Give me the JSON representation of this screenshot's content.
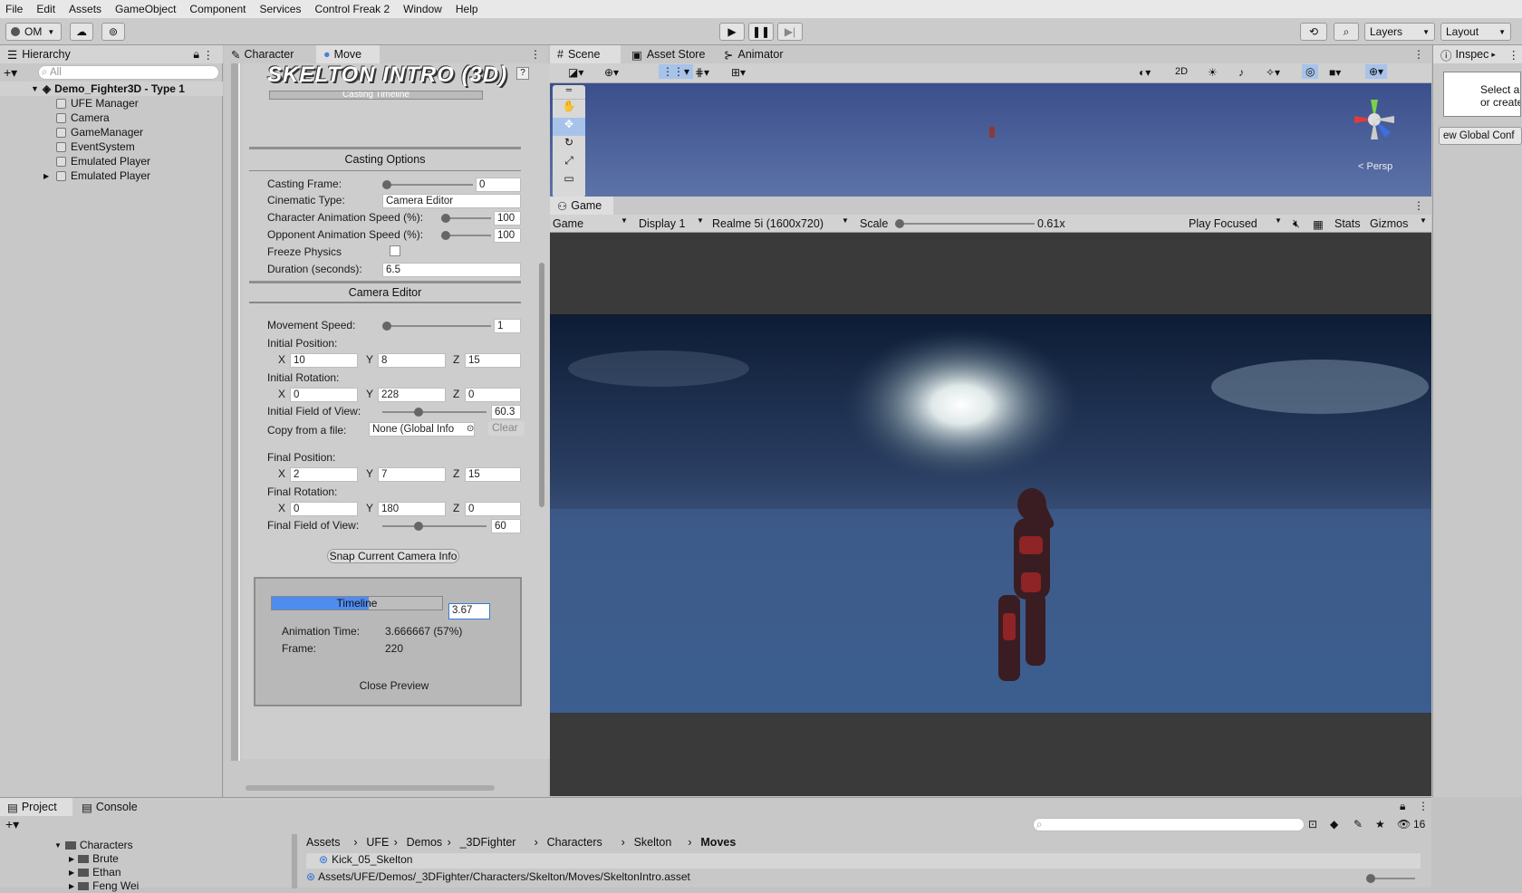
{
  "menu": [
    "File",
    "Edit",
    "Assets",
    "GameObject",
    "Component",
    "Services",
    "Control Freak 2",
    "Window",
    "Help"
  ],
  "toolbar": {
    "account": "OM",
    "layers": "Layers",
    "layout": "Layout"
  },
  "hierarchy": {
    "tab": "Hierarchy",
    "search_placeholder": "All",
    "scene": "Demo_Fighter3D - Type 1",
    "items": [
      "UFE Manager",
      "Camera",
      "GameManager",
      "EventSystem",
      "Emulated Player",
      "Emulated Player"
    ]
  },
  "editor": {
    "tabs": [
      "Character",
      "Move"
    ],
    "banner": "SKELTON INTRO (3D)",
    "timeline_header": "Casting Timeline",
    "casting_options": "Casting Options",
    "casting_frame_label": "Casting Frame:",
    "casting_frame": "0",
    "cinematic_type_label": "Cinematic Type:",
    "cinematic_type": "Camera Editor",
    "char_anim_label": "Character Animation Speed (%):",
    "char_anim": "100",
    "opp_anim_label": "Opponent Animation Speed (%):",
    "opp_anim": "100",
    "freeze_label": "Freeze Physics",
    "duration_label": "Duration (seconds):",
    "duration": "6.5",
    "camera_editor": "Camera Editor",
    "movement_label": "Movement Speed:",
    "movement": "1",
    "init_pos_label": "Initial Position:",
    "init_pos": {
      "x": "10",
      "y": "8",
      "z": "15"
    },
    "init_rot_label": "Initial Rotation:",
    "init_rot": {
      "x": "0",
      "y": "228",
      "z": "0"
    },
    "init_fov_label": "Initial Field of View:",
    "init_fov": "60.3",
    "copy_label": "Copy from a file:",
    "copy_value": "None (Global Info",
    "clear": "Clear",
    "final_pos_label": "Final Position:",
    "final_pos": {
      "x": "2",
      "y": "7",
      "z": "15"
    },
    "final_rot_label": "Final Rotation:",
    "final_rot": {
      "x": "0",
      "y": "180",
      "z": "0"
    },
    "final_fov_label": "Final Field of View:",
    "final_fov": "60",
    "snap_button": "Snap Current Camera Info",
    "timeline_label": "Timeline",
    "timeline_value": "3.67",
    "timeline_progress": 0.57,
    "anim_time_label": "Animation Time:",
    "anim_time": "3.666667 (57%)",
    "frame_label": "Frame:",
    "frame": "220",
    "close_preview": "Close Preview"
  },
  "scene": {
    "tabs": [
      "Scene",
      "Asset Store",
      "Animator"
    ],
    "persp": "< Persp",
    "mode_2d": "2D"
  },
  "game": {
    "tab": "Game",
    "view": "Game",
    "display": "Display 1",
    "resolution": "Realme 5i (1600x720)",
    "scale_label": "Scale",
    "scale": "0.61x",
    "play": "Play Focused",
    "stats": "Stats",
    "gizmos": "Gizmos"
  },
  "inspector": {
    "tab": "Inspec",
    "text1": "Select a",
    "text2": "or create",
    "button": "ew Global Conf"
  },
  "project": {
    "tabs": [
      "Project",
      "Console"
    ],
    "folders": [
      "Characters",
      "Brute",
      "Ethan",
      "Feng Wei"
    ],
    "breadcrumb": [
      "Assets",
      "UFE",
      "Demos",
      "_3DFighter",
      "Characters",
      "Skelton",
      "Moves"
    ],
    "file": "Kick_05_Skelton",
    "path": "Assets/UFE/Demos/_3DFighter/Characters/Skelton/Moves/SkeltonIntro.asset",
    "count": "16"
  }
}
